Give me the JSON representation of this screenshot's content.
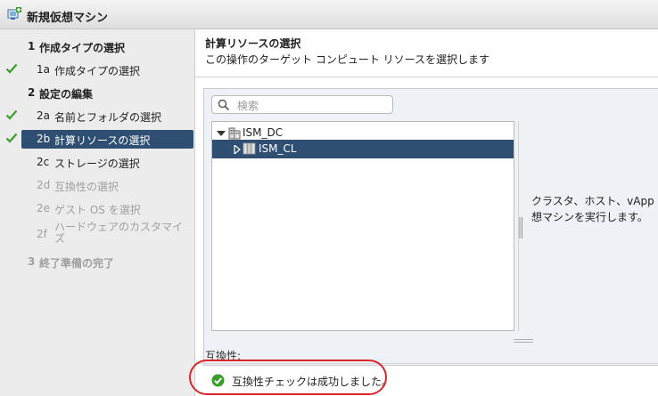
{
  "window": {
    "title": "新規仮想マシン",
    "icon": "new-vm-icon"
  },
  "nav": {
    "steps": [
      {
        "num": "1",
        "label": "作成タイプの選択",
        "kind": "step",
        "checked": false,
        "state": "normal"
      },
      {
        "num": "1a",
        "label": "作成タイプの選択",
        "kind": "sub",
        "checked": true,
        "state": "normal"
      },
      {
        "num": "2",
        "label": "設定の編集",
        "kind": "step",
        "checked": false,
        "state": "normal"
      },
      {
        "num": "2a",
        "label": "名前とフォルダの選択",
        "kind": "sub",
        "checked": true,
        "state": "normal"
      },
      {
        "num": "2b",
        "label": "計算リソースの選択",
        "kind": "sub",
        "checked": true,
        "state": "active"
      },
      {
        "num": "2c",
        "label": "ストレージの選択",
        "kind": "sub",
        "checked": false,
        "state": "normal"
      },
      {
        "num": "2d",
        "label": "互換性の選択",
        "kind": "sub",
        "checked": false,
        "state": "disabled"
      },
      {
        "num": "2e",
        "label": "ゲスト OS を選択",
        "kind": "sub",
        "checked": false,
        "state": "disabled"
      },
      {
        "num": "2f",
        "label": "ハードウェアのカスタマイズ",
        "kind": "sub",
        "checked": false,
        "state": "disabled"
      },
      {
        "num": "3",
        "label": "終了準備の完了",
        "kind": "step",
        "checked": false,
        "state": "disabled"
      }
    ]
  },
  "content": {
    "title": "計算リソースの選択",
    "description": "この操作のターゲット コンピュート リソースを選択します",
    "search": {
      "placeholder": "検索",
      "value": ""
    },
    "tree": {
      "datacenter": {
        "label": "ISM_DC",
        "icon": "datacenter-icon",
        "expanded": true
      },
      "cluster": {
        "label": "ISM_CL",
        "icon": "cluster-icon",
        "selected": true
      }
    },
    "info_lines": [
      "クラスタ、ホスト、vApp また",
      "想マシンを実行します。"
    ],
    "compatibility": {
      "label": "互換性:",
      "message": "互換性チェックは成功しました。",
      "status_icon": "success-check-icon"
    }
  },
  "colors": {
    "active_bg": "#2e4f72",
    "check_green": "#3a9c2a",
    "highlight_red": "#d9262b"
  }
}
